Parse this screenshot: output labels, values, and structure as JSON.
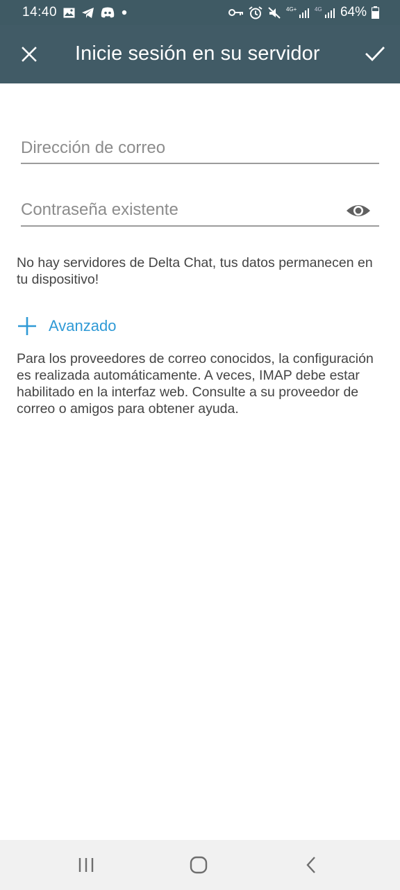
{
  "status_bar": {
    "time": "14:40",
    "battery_percent": "64%",
    "network_1": "4G+",
    "network_2": "4G",
    "icons_left": [
      "gallery-icon",
      "telegram-icon",
      "discord-icon",
      "dot-icon"
    ],
    "icons_right": [
      "key-icon",
      "alarm-icon",
      "mute-icon",
      "signal-icon",
      "signal-icon",
      "battery-icon"
    ]
  },
  "app_bar": {
    "title": "Inicie sesión en su servidor",
    "close_icon": "close-icon",
    "confirm_icon": "check-icon",
    "background_color": "#415b66"
  },
  "form": {
    "email_placeholder": "Dirección de correo",
    "email_value": "",
    "password_placeholder": "Contraseña existente",
    "password_value": "",
    "password_toggle_icon": "eye-icon"
  },
  "notice": "No hay servidores de Delta Chat, tus datos permanecen en tu dispositivo!",
  "advanced": {
    "label": "Avanzado",
    "icon": "plus-icon",
    "color": "#2f9ad6"
  },
  "help_text": "Para los proveedores de correo conocidos, la configuración es realizada automáticamente. A veces, IMAP debe estar habilitado en la interfaz web. Consulte a su proveedor de correo o amigos para obtener ayuda.",
  "nav_bar": {
    "buttons": [
      "recents-icon",
      "home-icon",
      "back-icon"
    ]
  }
}
